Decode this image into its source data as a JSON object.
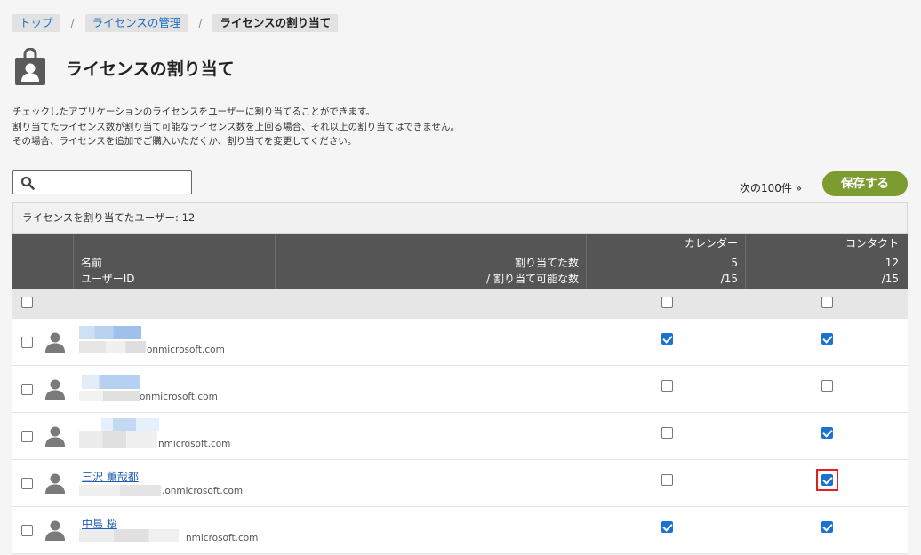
{
  "breadcrumb": [
    {
      "label": "トップ"
    },
    {
      "label": "ライセンスの管理"
    },
    {
      "label": "ライセンスの割り当て"
    }
  ],
  "page": {
    "title": "ライセンスの割り当て",
    "description": [
      "チェックしたアプリケーションのライセンスをユーザーに割り当てることができます。",
      "割り当てたライセンス数が割り当て可能なライセンス数を上回る場合、それ以上の割り当てはできません。",
      "その場合、ライセンスを追加でご購入いただくか、割り当てを変更してください。"
    ]
  },
  "search": {
    "placeholder": ""
  },
  "pager": {
    "next_label": "次の100件 »"
  },
  "actions": {
    "save_label": "保存する",
    "save_color": "#7c9c32"
  },
  "table": {
    "summary": "ライセンスを割り当てたユーザー: 12",
    "headers": {
      "name": "名前",
      "user_id": "ユーザーID",
      "assigned": "割り当てた数",
      "assignable": "/ 割り当て可能な数"
    },
    "apps": [
      {
        "name": "カレンダー",
        "assigned": "5",
        "total": "/15"
      },
      {
        "name": "コンタクト",
        "assigned": "12",
        "total": "/15"
      }
    ],
    "rows": [
      {
        "name": "",
        "user_id": "onmicrosoft.com",
        "calendar": true,
        "contact": true
      },
      {
        "name": "",
        "user_id": "onmicrosoft.com",
        "calendar": false,
        "contact": false
      },
      {
        "name": "",
        "user_id": "nmicrosoft.com",
        "calendar": false,
        "contact": true
      },
      {
        "name": "三沢 薫哉都",
        "user_id": ".onmicrosoft.com",
        "calendar": false,
        "contact": true
      },
      {
        "name": "中島 桜",
        "user_id": "nmicrosoft.com",
        "calendar": true,
        "contact": true
      }
    ]
  },
  "colors": {
    "header_bg": "#555555",
    "checkbox_checked": "#1a73d1",
    "focus_outline": "#e0201b",
    "link": "#1f6fc4"
  }
}
